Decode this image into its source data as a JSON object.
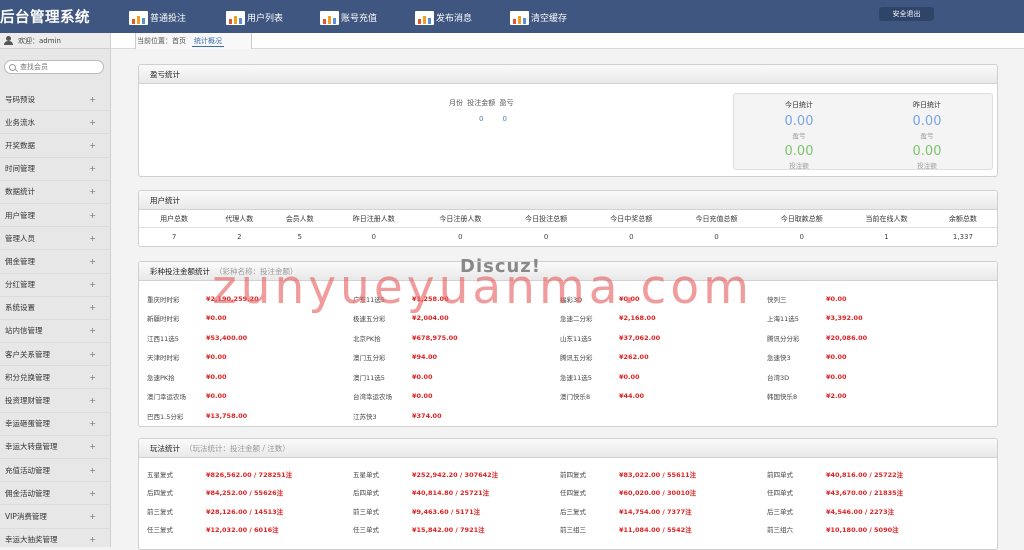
{
  "app": {
    "title": "后台管理系统",
    "logout": "安全退出"
  },
  "topnav": [
    {
      "label": "普通投注",
      "icon": "chart-icon"
    },
    {
      "label": "用户列表",
      "icon": "chart-icon"
    },
    {
      "label": "账号充值",
      "icon": "chart-icon"
    },
    {
      "label": "发布消息",
      "icon": "chart-icon"
    },
    {
      "label": "清空缓存",
      "icon": "chart-icon"
    }
  ],
  "sidebar": {
    "welcome": "欢迎：admin",
    "search_placeholder": "查找会员",
    "items": [
      "号码预设",
      "业务流水",
      "开奖数据",
      "时间管理",
      "数据统计",
      "用户管理",
      "管理人员",
      "佣金管理",
      "分红管理",
      "系统设置",
      "站内信管理",
      "客户关系管理",
      "积分兑换管理",
      "投资理财管理",
      "幸运砸蛋管理",
      "幸运大转盘管理",
      "充值活动管理",
      "佣金活动管理",
      "VIP消费管理",
      "幸运大抽奖管理"
    ],
    "expand_symbol": "+"
  },
  "breadcrumb": {
    "prefix": "当前位置：",
    "home": "首页",
    "current": "统计概况"
  },
  "profit_panel": {
    "title": "盈亏统计",
    "columns_text": "月份 投注金额 盈亏",
    "values": [
      "0",
      "0"
    ],
    "today": {
      "label": "今日统计",
      "profit": "0.00",
      "profit_label": "盈亏",
      "bet": "0.00",
      "bet_label": "投注额"
    },
    "yesterday": {
      "label": "昨日统计",
      "profit": "0.00",
      "profit_label": "盈亏",
      "bet": "0.00",
      "bet_label": "投注额"
    }
  },
  "user_panel": {
    "title": "用户统计",
    "headers": [
      "用户总数",
      "代理人数",
      "会员人数",
      "昨日注册人数",
      "今日注册人数",
      "今日投注总额",
      "今日中奖总额",
      "今日充值总额",
      "今日取款总额",
      "当前在线人数",
      "余额总数"
    ],
    "values": [
      "7",
      "2",
      "5",
      "0",
      "0",
      "0",
      "0",
      "0",
      "0",
      "1",
      "1,337"
    ]
  },
  "lottery_panel": {
    "title": "彩种投注金额统计",
    "subtitle": "（彩种名称：投注金额）",
    "rows": [
      [
        [
          "重庆时时彩",
          "¥2,190,259.20"
        ],
        [
          "广东11选5",
          "¥1,258.00"
        ],
        [
          "福彩3D",
          "¥0.00"
        ],
        [
          "快列三",
          "¥0.00"
        ]
      ],
      [
        [
          "新疆时时彩",
          "¥0.00"
        ],
        [
          "极速五分彩",
          "¥2,004.00"
        ],
        [
          "急速二分彩",
          "¥2,168.00"
        ],
        [
          "上海11选5",
          "¥3,392.00"
        ]
      ],
      [
        [
          "江西11选5",
          "¥53,400.00"
        ],
        [
          "北京PK拾",
          "¥678,975.00"
        ],
        [
          "山东11选5",
          "¥37,062.00"
        ],
        [
          "腾讯分分彩",
          "¥20,086.00"
        ]
      ],
      [
        [
          "天津时时彩",
          "¥0.00"
        ],
        [
          "澳门五分彩",
          "¥94.00"
        ],
        [
          "腾讯五分彩",
          "¥262.00"
        ],
        [
          "急速快3",
          "¥0.00"
        ]
      ],
      [
        [
          "急速PK拾",
          "¥0.00"
        ],
        [
          "澳门11选5",
          "¥0.00"
        ],
        [
          "急速11选5",
          "¥0.00"
        ],
        [
          "台湾3D",
          "¥0.00"
        ]
      ],
      [
        [
          "澳门幸运农场",
          "¥0.00"
        ],
        [
          "台湾幸运农场",
          "¥0.00"
        ],
        [
          "澳门快乐8",
          "¥44.00"
        ],
        [
          "韩国快乐8",
          "¥2.00"
        ]
      ],
      [
        [
          "巴西1.5分彩",
          "¥13,758.00"
        ],
        [
          "江苏快3",
          "¥374.00"
        ]
      ]
    ]
  },
  "play_panel": {
    "title": "玩法统计",
    "subtitle": "（玩法统计：投注金额 / 注数）",
    "rows": [
      [
        [
          "五星复式",
          "¥826,562.00 / 728251注"
        ],
        [
          "五星单式",
          "¥252,942.20 / 307642注"
        ],
        [
          "前四复式",
          "¥83,022.00 / 55611注"
        ],
        [
          "前四单式",
          "¥40,816.00 / 25722注"
        ]
      ],
      [
        [
          "后四复式",
          "¥84,252.00 / 55626注"
        ],
        [
          "后四单式",
          "¥40,814.80 / 25721注"
        ],
        [
          "任四复式",
          "¥60,020.00 / 30010注"
        ],
        [
          "任四单式",
          "¥43,670.00 / 21835注"
        ]
      ],
      [
        [
          "前三复式",
          "¥28,126.00 / 14513注"
        ],
        [
          "前三单式",
          "¥9,463.60 / 5171注"
        ],
        [
          "后三复式",
          "¥14,754.00 / 7377注"
        ],
        [
          "后三单式",
          "¥4,546.00 / 2273注"
        ]
      ],
      [
        [
          "任三复式",
          "¥12,032.00 / 6016注"
        ],
        [
          "任三单式",
          "¥15,842.00 / 7921注"
        ],
        [
          "前三组三",
          "¥11,084.00 / 5542注"
        ],
        [
          "前三组六",
          "¥10,180.00 / 5090注"
        ]
      ]
    ]
  },
  "watermark": {
    "small": "Discuz!",
    "big": "zunyueyuanma.com"
  }
}
